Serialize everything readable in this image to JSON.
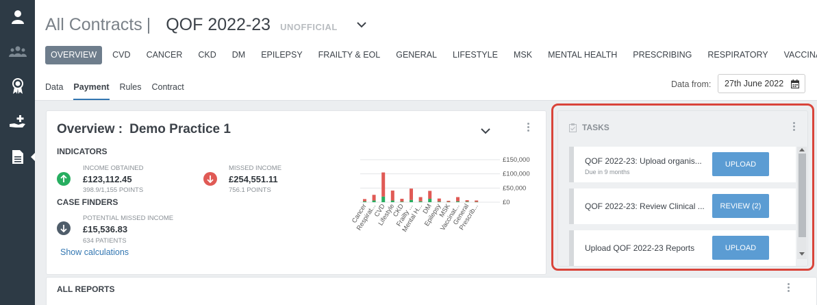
{
  "header": {
    "title": "All Contracts",
    "separator": "|",
    "contract": "QOF 2022-23",
    "badge": "UNOFFICIAL"
  },
  "nav": {
    "tabs": [
      "OVERVIEW",
      "CVD",
      "CANCER",
      "CKD",
      "DM",
      "EPILEPSY",
      "FRAILTY & EOL",
      "GENERAL",
      "LIFESTYLE",
      "MSK",
      "MENTAL HEALTH",
      "PRESCRIBING",
      "RESPIRATORY",
      "VACCINATIONS"
    ],
    "active": "OVERVIEW"
  },
  "sub_tabs": {
    "items": [
      "Data",
      "Payment",
      "Rules",
      "Contract"
    ],
    "active": "Payment"
  },
  "data_from": {
    "label": "Data from:",
    "date": "27th June 2022"
  },
  "overview": {
    "heading": "Overview :",
    "practice": "Demo Practice 1",
    "indicators_label": "INDICATORS",
    "income_label": "INCOME OBTAINED",
    "income_value": "£123,112.45",
    "income_points": "398.9/1,155 POINTS",
    "missed_label": "MISSED INCOME",
    "missed_value": "£254,551.11",
    "missed_points": "756.1 POINTS",
    "case_finders_label": "CASE FINDERS",
    "potential_label": "POTENTIAL MISSED INCOME",
    "potential_value": "£15,536.83",
    "potential_patients": "634 PATIENTS",
    "show_calc": "Show calculations"
  },
  "chart_data": {
    "type": "bar",
    "stacked": true,
    "categories": [
      "Cancer",
      "Respirat...",
      "CVD",
      "Lifestyle",
      "CKD",
      "Frailty ...",
      "Mental H...",
      "DM",
      "Epilepsy",
      "MSK",
      "Vaccinat...",
      "General",
      "Prescrib..."
    ],
    "series": [
      {
        "color": "#27ae60",
        "values": [
          3000,
          6000,
          20000,
          6000,
          2000,
          8000,
          3000,
          12000,
          2000,
          1000,
          3000,
          2000,
          1000
        ]
      },
      {
        "color": "#e05a55",
        "values": [
          8000,
          20000,
          85000,
          35000,
          10000,
          40000,
          15000,
          28000,
          11000,
          4000,
          15000,
          5000,
          5000
        ]
      }
    ],
    "yticks": [
      "£150,000",
      "£100,000",
      "£50,000",
      "£0"
    ],
    "ylim": [
      0,
      150000
    ]
  },
  "tasks": {
    "heading": "TASKS",
    "items": [
      {
        "title": "QOF 2022-23: Upload organis...",
        "due": "Due in 9 months",
        "button": "UPLOAD"
      },
      {
        "title": "QOF 2022-23: Review Clinical ...",
        "due": "",
        "button": "REVIEW (2)"
      },
      {
        "title": "Upload QOF 2022-23 Reports",
        "due": "",
        "button": "UPLOAD"
      }
    ]
  },
  "reports": {
    "heading": "ALL REPORTS"
  },
  "colors": {
    "accent": "#3276b1",
    "button": "#5b9cd3",
    "up": "#27ae60",
    "down": "#e05a55",
    "sidebar": "#2d3a45",
    "highlight": "#d9443a"
  }
}
